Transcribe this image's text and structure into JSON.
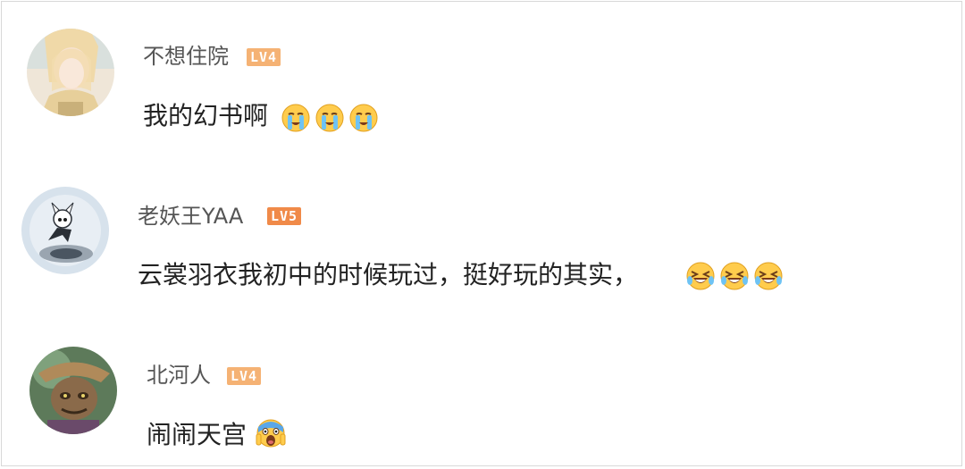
{
  "comments": [
    {
      "username": "不想住院",
      "level": "LV4",
      "text": "我的幻书啊",
      "emoji_name": "crying-emoji",
      "emoji_count": 3
    },
    {
      "username": "老妖王YAA",
      "level": "LV5",
      "text": "云裳羽衣我初中的时候玩过，挺好玩的其实，",
      "emoji_name": "laugh-crying-emoji",
      "emoji_count": 3
    },
    {
      "username": "北河人",
      "level": "LV4",
      "text": "闹闹天宫",
      "emoji_name": "screaming-emoji",
      "emoji_count": 1
    }
  ],
  "colors": {
    "level4": "#f5b274",
    "level5": "#f08a49",
    "username": "#555555",
    "text": "#222222"
  }
}
